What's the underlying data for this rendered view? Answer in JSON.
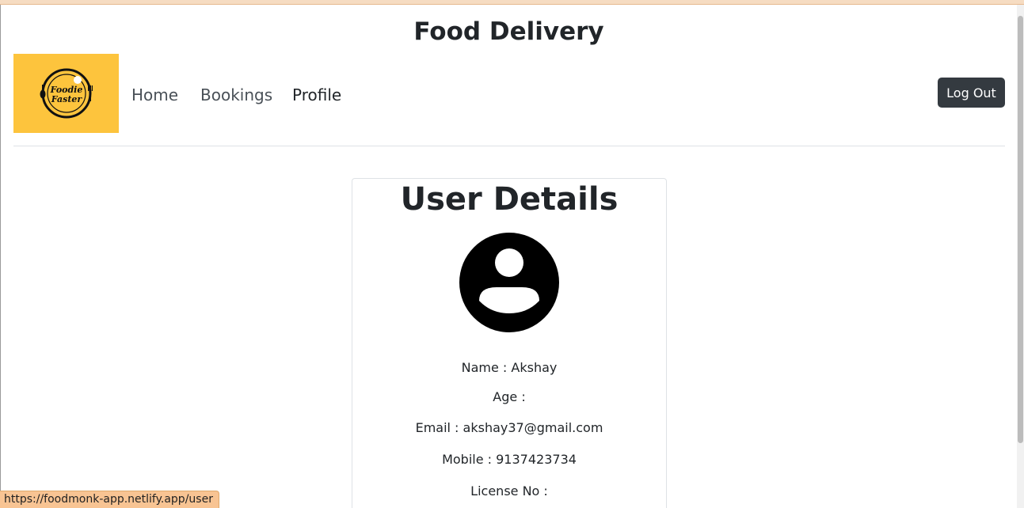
{
  "site": {
    "title": "Food Delivery"
  },
  "logo": {
    "alt": "Foodie Faster",
    "line1": "Foodie",
    "line2": "Faster"
  },
  "nav": {
    "items": [
      {
        "label": "Home"
      },
      {
        "label": "Bookings"
      },
      {
        "label": "Profile"
      }
    ],
    "logout_label": "Log Out"
  },
  "card": {
    "title": "User Details",
    "avatar_icon": "user-circle-icon",
    "fields": {
      "name": "Name : Akshay",
      "age": "Age :",
      "email": "Email : akshay37@gmail.com",
      "mobile": "Mobile : 9137423734",
      "license": "License No :"
    }
  },
  "status_bar": {
    "url": "https://foodmonk-app.netlify.app/user"
  },
  "colors": {
    "logo_background": "#fdc43d",
    "logout_button": "#343a40",
    "status_bar": "#f8c493"
  }
}
